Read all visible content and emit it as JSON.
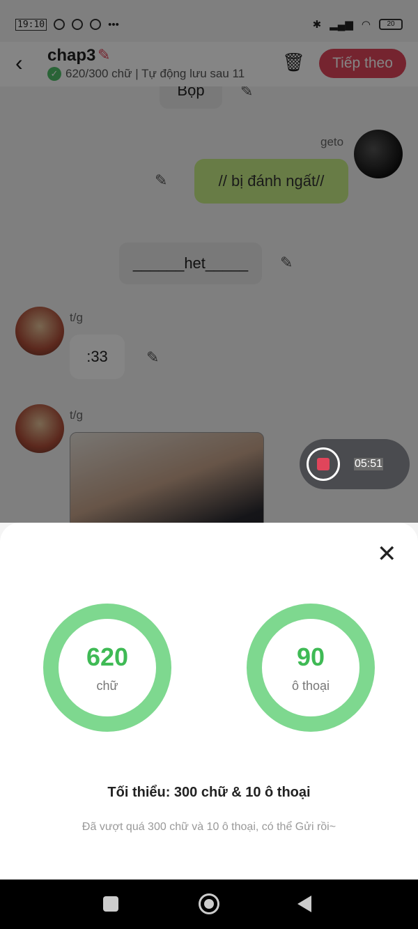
{
  "status_bar": {
    "time": "19:10",
    "battery": "20"
  },
  "header": {
    "title": "chap3",
    "subtitle": "620/300 chữ | Tự động lưu sau 11",
    "next_button": "Tiếp theo"
  },
  "chat": {
    "top_narration": "Bộp",
    "message_sender": "geto",
    "message_text": "// bị đánh ngất//",
    "narration": "______het_____",
    "reply_sender": "t/g",
    "reply_text": ":33",
    "image_sender": "t/g"
  },
  "recorder": {
    "time": "05:51"
  },
  "sheet": {
    "words_value": "620",
    "words_label": "chữ",
    "dialogues_value": "90",
    "dialogues_label": "ô thoại",
    "minimum_text": "Tối thiểu: 300 chữ & 10 ô thoại",
    "note_text": "Đã vượt quá 300 chữ và 10 ô thoại, có thể Gửi rồi~"
  }
}
